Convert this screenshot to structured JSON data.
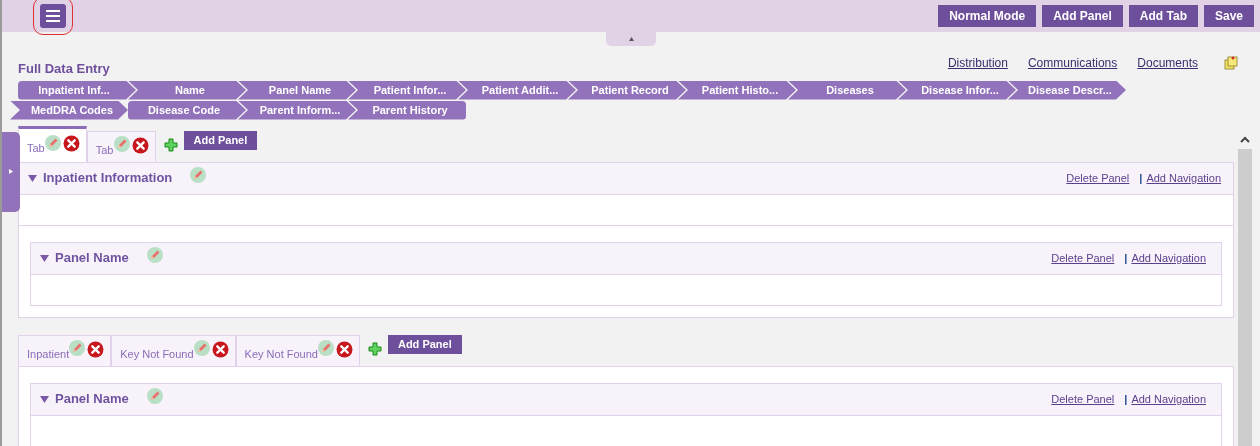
{
  "toolbar": {
    "buttons": [
      "Normal Mode",
      "Add Panel",
      "Add Tab",
      "Save"
    ]
  },
  "title": "Full Data Entry",
  "links": [
    "Distribution",
    "Communications",
    "Documents"
  ],
  "steps": [
    "Inpatient Inf...",
    "Name",
    "Panel Name",
    "Patient Infor...",
    "Patient Addit...",
    "Patient Record",
    "Patient Histo...",
    "Diseases",
    "Disease Infor...",
    "Disease Descr...",
    "MedDRA Codes",
    "Disease Code",
    "Parent Inform...",
    "Parent History"
  ],
  "tab_groups": [
    {
      "tabs": [
        {
          "label": "Tab",
          "selected": true
        },
        {
          "label": "Tab",
          "selected": false
        }
      ],
      "add_button": "Add Panel",
      "header": {
        "title": "Inpatient Information",
        "delete": "Delete Panel",
        "separator": "|",
        "navigation": "Add Navigation"
      },
      "panels": [
        {
          "title": "Panel Name",
          "delete": "Delete Panel",
          "separator": "|",
          "navigation": "Add Navigation"
        }
      ]
    },
    {
      "tabs": [
        {
          "label": "Inpatient",
          "selected": false
        },
        {
          "label": "Key Not Found",
          "selected": false
        },
        {
          "label": "Key Not Found",
          "selected": false
        }
      ],
      "add_button": "Add Panel",
      "panels": [
        {
          "title": "Panel Name",
          "delete": "Delete Panel",
          "separator": "|",
          "navigation": "Add Navigation"
        }
      ]
    }
  ]
}
